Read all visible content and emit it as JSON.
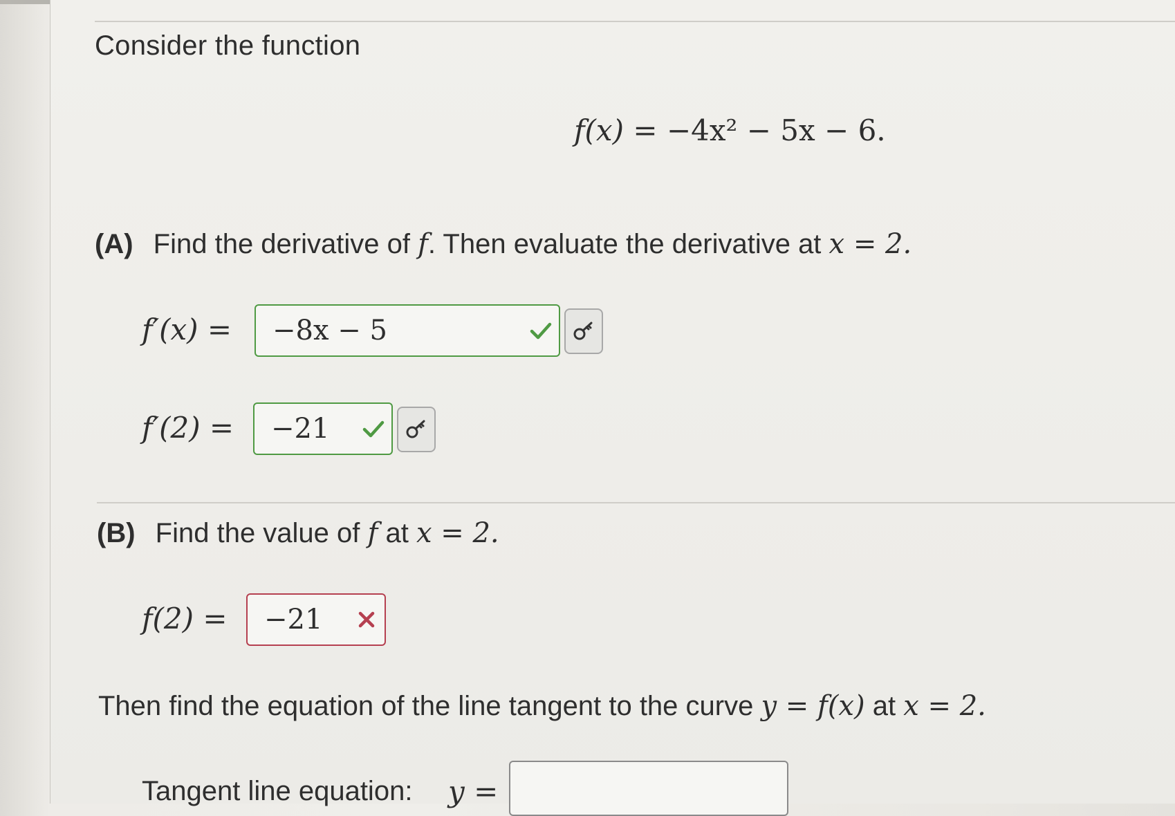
{
  "intro_text": "Consider the function",
  "function_display": {
    "lhs": "f(x)",
    "equals": "=",
    "rhs": "−4x² − 5x − 6."
  },
  "part_a": {
    "letter": "(A)",
    "text_1": "Find the derivative of",
    "var_f": "f",
    "text_2": ". Then evaluate the derivative at",
    "cond": "x = 2."
  },
  "deriv_row": {
    "label": "f′(x) =",
    "value": "−8x − 5",
    "status": "correct",
    "key_icon": "key-icon"
  },
  "deriv2_row": {
    "label": "f′(2) =",
    "value": "−21",
    "status": "correct",
    "key_icon": "key-icon"
  },
  "part_b": {
    "letter": "(B)",
    "text_1": "Find the value of",
    "var_f": "f",
    "text_2": "at",
    "cond": "x = 2."
  },
  "f2_row": {
    "label": "f(2) =",
    "value": "−21",
    "status": "incorrect"
  },
  "then_line": {
    "text_1": "Then find the equation of the line tangent to the curve",
    "math_1": "y = f(x)",
    "text_2": "at",
    "math_2": "x = 2."
  },
  "tangent": {
    "label": "Tangent line equation:",
    "y_label": "y =",
    "value": ""
  },
  "colors": {
    "correct": "#4f9a43",
    "incorrect": "#b54050",
    "border_neutral": "#8a8a8a"
  }
}
